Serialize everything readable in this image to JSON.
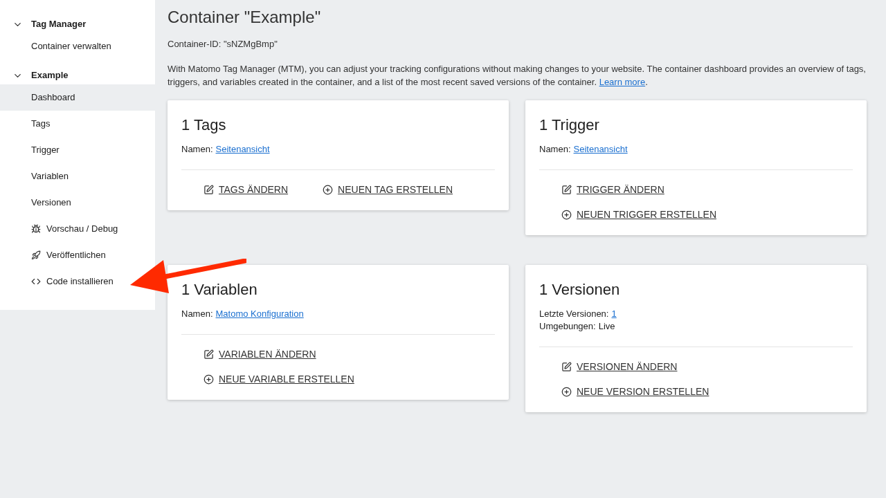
{
  "sidebar": {
    "sections": [
      {
        "title": "Tag Manager",
        "expanded": true,
        "items": [
          {
            "label": "Container verwalten",
            "kind": "plain",
            "selected": false
          }
        ]
      },
      {
        "title": "Example",
        "expanded": true,
        "items": [
          {
            "label": "Dashboard",
            "kind": "plain",
            "selected": true
          },
          {
            "label": "Tags",
            "kind": "plain",
            "selected": false
          },
          {
            "label": "Trigger",
            "kind": "plain",
            "selected": false
          },
          {
            "label": "Variablen",
            "kind": "plain",
            "selected": false
          },
          {
            "label": "Versionen",
            "kind": "plain",
            "selected": false
          },
          {
            "label": "Vorschau / Debug",
            "kind": "bug",
            "selected": false
          },
          {
            "label": "Veröffentlichen",
            "kind": "rocket",
            "selected": false
          },
          {
            "label": "Code installieren",
            "kind": "code",
            "selected": false
          }
        ]
      }
    ]
  },
  "page": {
    "title": "Container \"Example\"",
    "container_id": "Container-ID: \"sNZMgBmp\"",
    "intro": "With Matomo Tag Manager (MTM), you can adjust your tracking configurations without making changes to your website. The container dashboard provides an overview of tags, triggers, and variables created in the container, and a list of the most recent saved versions of the container.",
    "intro_link": "Learn more",
    "intro_end": "."
  },
  "cards": [
    {
      "title": "1 Tags",
      "kind": "inline",
      "info": [
        {
          "label": "Namen:",
          "value": "Seitenansicht",
          "link": true
        }
      ],
      "actions": [
        {
          "kind": "edit",
          "label": "TAGS ÄNDERN"
        },
        {
          "kind": "create",
          "label": "NEUEN TAG ERSTELLEN"
        }
      ]
    },
    {
      "title": "1 Trigger",
      "kind": "stacked",
      "info": [
        {
          "label": "Namen:",
          "value": "Seitenansicht",
          "link": true
        }
      ],
      "actions": [
        {
          "kind": "edit",
          "label": "TRIGGER ÄNDERN"
        },
        {
          "kind": "create",
          "label": "NEUEN TRIGGER ERSTELLEN"
        }
      ]
    },
    {
      "title": "1 Variablen",
      "kind": "stacked",
      "info": [
        {
          "label": "Namen:",
          "value": "Matomo Konfiguration",
          "link": true
        }
      ],
      "actions": [
        {
          "kind": "edit",
          "label": "VARIABLEN ÄNDERN"
        },
        {
          "kind": "create",
          "label": "NEUE VARIABLE ERSTELLEN"
        }
      ]
    },
    {
      "title": "1 Versionen",
      "kind": "stacked",
      "info": [
        {
          "label": "Letzte Versionen:",
          "value": "1",
          "link": true
        },
        {
          "label": "Umgebungen:",
          "value": "Live",
          "link": false
        }
      ],
      "actions": [
        {
          "kind": "edit",
          "label": "VERSIONEN ÄNDERN"
        },
        {
          "kind": "create",
          "label": "NEUE VERSION ERSTELLEN"
        }
      ]
    }
  ]
}
